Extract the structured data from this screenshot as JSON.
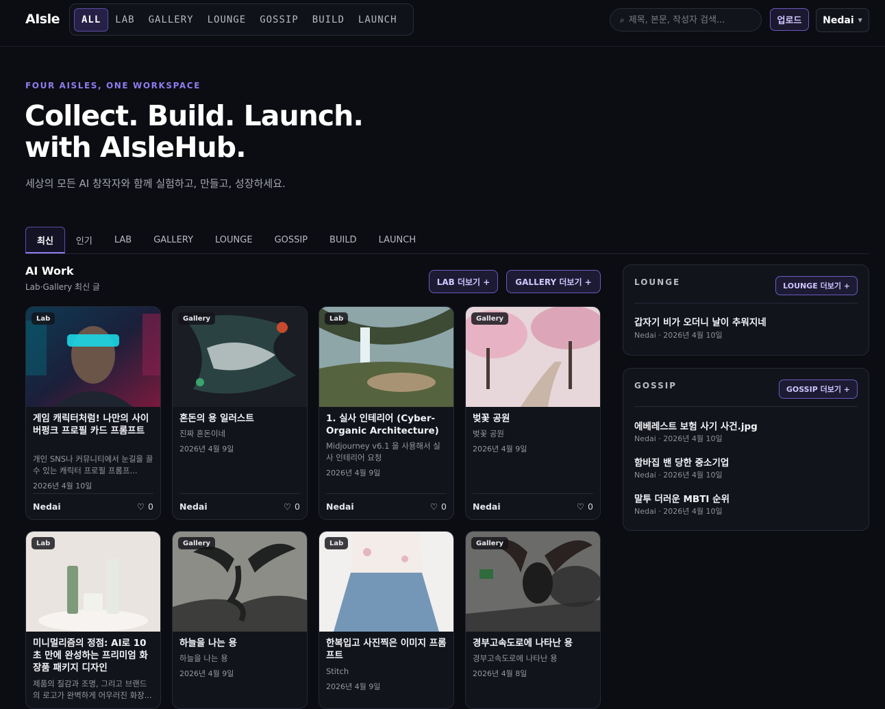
{
  "app": {
    "logo": "AIsle"
  },
  "topnav": [
    "ALL",
    "LAB",
    "GALLERY",
    "LOUNGE",
    "GOSSIP",
    "BUILD",
    "LAUNCH"
  ],
  "search": {
    "placeholder": "제목, 본문, 작성자 검색..."
  },
  "header": {
    "upload_label": "업로드",
    "user_label": "Nedai"
  },
  "hero": {
    "eyebrow": "FOUR AISLES, ONE WORKSPACE",
    "line1": "Collect. Build. Launch.",
    "line2": "with AIsleHub.",
    "subtitle": "세상의 모든 AI 창작자와 함께 실험하고, 만들고, 성장하세요."
  },
  "tabs": [
    "최신",
    "인기",
    "LAB",
    "GALLERY",
    "LOUNGE",
    "GOSSIP",
    "BUILD",
    "LAUNCH"
  ],
  "ai_work": {
    "title": "AI Work",
    "subtitle": "Lab·Gallery 최신 글",
    "lab_more": "LAB 더보기 +",
    "gallery_more": "GALLERY 더보기 +"
  },
  "cards": [
    {
      "badge": "Lab",
      "title": "게임 캐릭터처럼! 나만의 사이버펑크 프로필 카드 프롬프트",
      "desc": "개인 SNS나 커뮤니티에서 눈길을 끌 수 있는 캐릭터 프로필 프롬프...",
      "date": "2026년 4월 10일",
      "author": "Nedai",
      "likes": "0"
    },
    {
      "badge": "Gallery",
      "title": "혼돈의 용 일러스트",
      "desc": "진짜 혼돈이네",
      "date": "2026년 4월 9일",
      "author": "Nedai",
      "likes": "0"
    },
    {
      "badge": "Lab",
      "title": "1. 실사 인테리어 (Cyber-Organic Architecture)",
      "desc": "Midjourney v6.1 을 사용해서 실사 인테리어 요청",
      "date": "2026년 4월 9일",
      "author": "Nedai",
      "likes": "0"
    },
    {
      "badge": "Gallery",
      "title": "벚꽃 공원",
      "desc": "벚꽃 공원",
      "date": "2026년 4월 9일",
      "author": "Nedai",
      "likes": "0"
    },
    {
      "badge": "Lab",
      "title": "미니멀리즘의 정점: AI로 10초 만에 완성하는 프리미엄 화장품 패키지 디자인",
      "desc": "제품의 질감과 조명, 그리고 브랜드의 로고가 완벽하게 어우러진 화장...",
      "date": "",
      "author": "",
      "likes": ""
    },
    {
      "badge": "Gallery",
      "title": "하늘을 나는 용",
      "desc": "하늘을 나는 용",
      "date": "2026년 4월 9일",
      "author": "",
      "likes": ""
    },
    {
      "badge": "Lab",
      "title": "한복입고 사진찍은 이미지 프롬프트",
      "desc": "Stitch",
      "date": "2026년 4월 9일",
      "author": "",
      "likes": ""
    },
    {
      "badge": "Gallery",
      "title": "경부고속도로에 나타난 용",
      "desc": "경부고속도로에 나타난 용",
      "date": "2026년 4월 8일",
      "author": "",
      "likes": ""
    }
  ],
  "lounge": {
    "title": "LOUNGE",
    "more": "LOUNGE 더보기 +",
    "items": [
      {
        "title": "갑자기 비가 오더니 날이 추워지네",
        "meta": "Nedai · 2026년 4월 10일"
      }
    ]
  },
  "gossip": {
    "title": "GOSSIP",
    "more": "GOSSIP 더보기 +",
    "items": [
      {
        "title": "에베레스트 보험 사기 사건.jpg",
        "meta": "Nedai · 2026년 4월 10일"
      },
      {
        "title": "함바집 밴 당한 중소기업",
        "meta": "Nedai · 2026년 4월 10일"
      },
      {
        "title": "말투 더러운 MBTI 순위",
        "meta": "Nedai · 2026년 4월 10일"
      }
    ]
  },
  "colors": {
    "accent": "#8f7cf0",
    "background": "#0b0d12",
    "card": "#12141b"
  }
}
